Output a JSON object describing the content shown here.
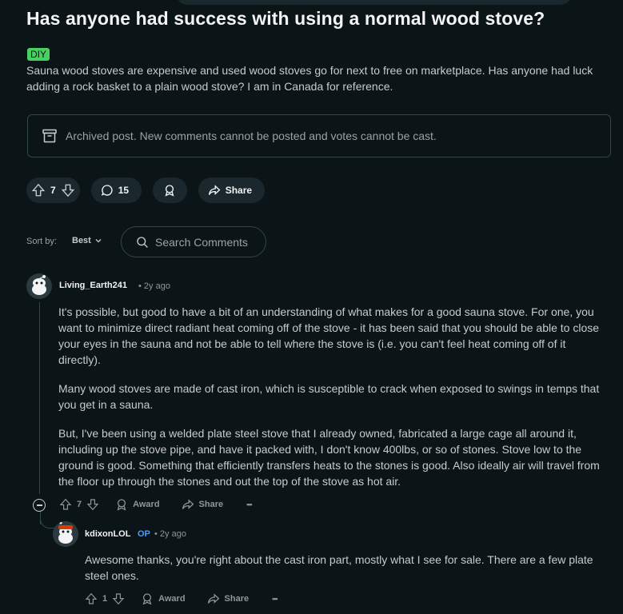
{
  "post": {
    "title": "Has anyone had success with using a normal wood stove?",
    "flair": "DIY",
    "body": "Sauna wood stoves are expensive and used wood stoves go for next to free on marketplace. Has anyone had luck adding a rock basket to a plain wood stove? I am in Canada for reference.",
    "archived_notice": "Archived post. New comments cannot be posted and votes cannot be cast.",
    "votes": "7",
    "comments_count": "15",
    "share_label": "Share"
  },
  "sort": {
    "label": "Sort by:",
    "value": "Best",
    "search_placeholder": "Search Comments"
  },
  "comments": [
    {
      "author": "Living_Earth241",
      "age": "• 2y ago",
      "paragraphs": [
        "It's possible, but good to have a bit of an understanding of what makes for a good sauna stove. For one, you want to minimize direct radiant heat coming off of the stove - it has been said that you should be able to close your eyes in the sauna and not be able to tell where the stove is (i.e. you can't feel heat coming off of it directly).",
        "Many wood stoves are made of cast iron, which is susceptible to crack when exposed to swings in temps that you get in a sauna.",
        "But, I've been using a welded plate steel stove that I already owned, fabricated a large cage all around it, including up the stove pipe, and have it packed with, I don't know 400lbs, or so of stones. Stove low to the ground is good. Something that efficiently transfers heats to the stones is good. Also ideally air will travel from the floor up through the stones and out the top of the stove as hot air."
      ],
      "votes": "7",
      "award_label": "Award",
      "share_label": "Share",
      "more_label": "•••"
    },
    {
      "author": "kdixonLOL",
      "op_badge": "OP",
      "age": "• 2y ago",
      "paragraphs": [
        "Awesome thanks, you're right about the cast iron part, mostly what I see for sale. There are a few plate steel ones."
      ],
      "votes": "1",
      "award_label": "Award",
      "share_label": "Share",
      "more_label": "•••"
    }
  ],
  "colors": {
    "background": "#0b1416",
    "flair": "#46d160",
    "op": "#4e9bff",
    "pill": "#1a282d"
  }
}
